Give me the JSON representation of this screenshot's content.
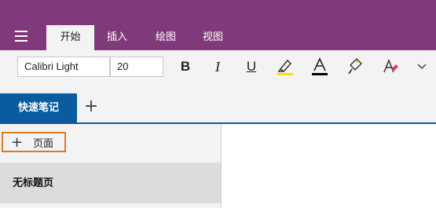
{
  "ribbon": {
    "tabs": [
      {
        "label": "开始"
      },
      {
        "label": "插入"
      },
      {
        "label": "绘图"
      },
      {
        "label": "视图"
      }
    ],
    "active_tab": "开始",
    "color": "#80397b"
  },
  "toolbar": {
    "font_name": "Calibri Light",
    "font_size": "20",
    "bold": "B",
    "italic": "I",
    "underline": "U",
    "highlight_color": "#f2e600",
    "font_color": "#000000",
    "icons": [
      "bold-icon",
      "italic-icon",
      "underline-icon",
      "highlighter-icon",
      "font-color-icon",
      "format-painter-icon",
      "clear-formatting-icon",
      "chevron-down-icon"
    ]
  },
  "section": {
    "name": "快速笔记",
    "add_symbol": "+",
    "color": "#0a5c9e"
  },
  "pages": {
    "add_label": "页面",
    "items": [
      {
        "title": "无标题页"
      }
    ],
    "highlight_color": "#e07a1f"
  }
}
